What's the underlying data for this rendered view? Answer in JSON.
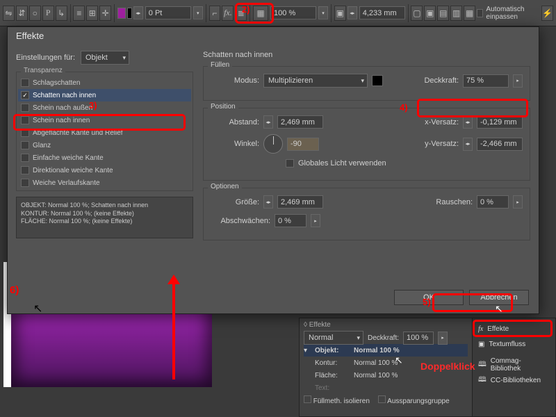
{
  "toolbar": {
    "stroke_value": "0 Pt",
    "scale_value": "100 %",
    "dim_value": "4,233 mm",
    "autofit": "Automatisch einpassen"
  },
  "dialog": {
    "title": "Effekte",
    "settings_label": "Einstellungen für:",
    "settings_value": "Objekt",
    "group_transparenz": "Transparenz",
    "effects": [
      "Schlagschatten",
      "Schatten nach innen",
      "Schein nach außen",
      "Schein nach innen",
      "Abgeflachte Kante und Relief",
      "Glanz",
      "Einfache weiche Kante",
      "Direktionale weiche Kante",
      "Weiche Verlaufskante"
    ],
    "summary_l1": "OBJEKT: Normal 100 %; Schatten nach innen",
    "summary_l2": "KONTUR: Normal 100 %; (keine Effekte)",
    "summary_l3": "FLÄCHE: Normal 100 %; (keine Effekte)",
    "right_head": "Schatten nach innen",
    "fill_t": "Füllen",
    "mode_l": "Modus:",
    "mode_v": "Multiplizieren",
    "opacity_l": "Deckkraft:",
    "opacity_v": "75 %",
    "pos_t": "Position",
    "dist_l": "Abstand:",
    "dist_v": "2,469 mm",
    "ang_l": "Winkel:",
    "ang_v": "-90",
    "gl_l": "Globales Licht verwenden",
    "xv_l": "x-Versatz:",
    "xv_v": "-0,129 mm",
    "yv_l": "y-Versatz:",
    "yv_v": "-2,466 mm",
    "opt_t": "Optionen",
    "size_l": "Größe:",
    "size_v": "2,469 mm",
    "noise_l": "Rauschen:",
    "noise_v": "0 %",
    "choke_l": "Abschwächen:",
    "choke_v": "0 %",
    "ok": "OK",
    "cancel": "Abbrechen"
  },
  "panel": {
    "title": "Effekte",
    "mode": "Normal",
    "op_l": "Deckkraft:",
    "op_v": "100 %",
    "obj_l": "Objekt:",
    "obj_v": "Normal 100 %",
    "kontur_l": "Kontur:",
    "kontur_v": "Normal 100 %",
    "flaeche_l": "Fläche:",
    "flaeche_v": "Normal 100 %",
    "text_l": "Text:",
    "iso": "Füllmeth. isolieren",
    "aussparung": "Aussparungsgruppe",
    "side_effekte": "Effekte",
    "side_textum": "Textumfluss",
    "side_commag": "Commag-Bibliothek",
    "side_cc": "CC-Bibliotheken"
  },
  "ann": {
    "a2": "2)",
    "a3": "3)",
    "a4": "4)",
    "a5": "5)",
    "a6": "6)",
    "dk": "Doppelklick"
  }
}
